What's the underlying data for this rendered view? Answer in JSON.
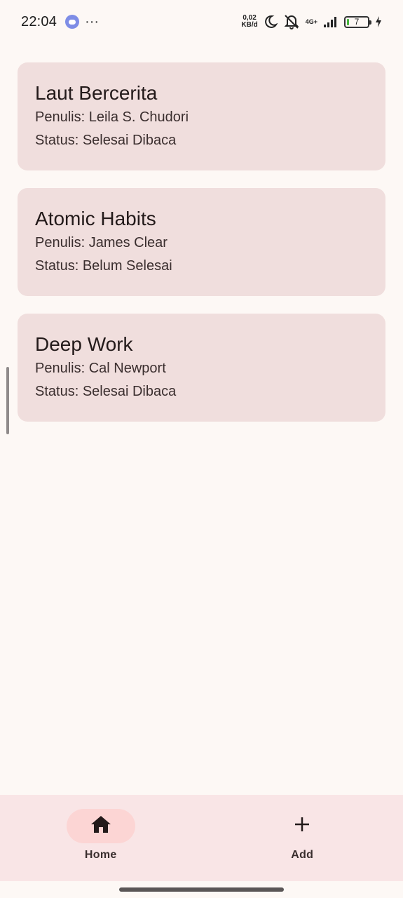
{
  "status_bar": {
    "time": "22:04",
    "notification_icon": "discord-icon",
    "more_indicator": "···",
    "speed_value": "0,02",
    "speed_unit": "KB/d",
    "network_label": "4G+",
    "battery_level": "7",
    "icons": [
      "moon-icon",
      "mute-icon",
      "signal-icon",
      "battery-icon",
      "charging-icon"
    ]
  },
  "books": [
    {
      "title": "Laut Bercerita",
      "author": "Penulis: Leila S. Chudori",
      "status": "Status: Selesai Dibaca"
    },
    {
      "title": "Atomic Habits",
      "author": "Penulis: James Clear",
      "status": "Status: Belum Selesai"
    },
    {
      "title": "Deep Work",
      "author": "Penulis: Cal Newport",
      "status": "Status: Selesai Dibaca"
    }
  ],
  "bottom_nav": {
    "items": [
      {
        "label": "Home",
        "icon": "home-icon",
        "active": true
      },
      {
        "label": "Add",
        "icon": "plus-icon",
        "active": false
      }
    ]
  },
  "colors": {
    "background": "#fdf8f5",
    "card": "#f0dedd",
    "nav_background": "#f9e5e6",
    "nav_active_pill": "#fcd5d4",
    "text_primary": "#231a1a",
    "battery_fill": "#47b53b"
  }
}
